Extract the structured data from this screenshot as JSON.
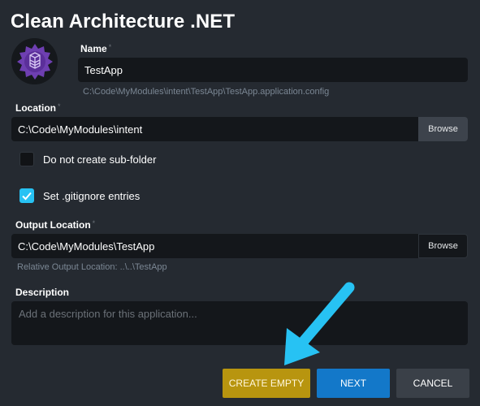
{
  "dialog": {
    "title": "Clean Architecture .NET"
  },
  "name": {
    "label": "Name",
    "value": "TestApp",
    "config_path": "C:\\Code\\MyModules\\intent\\TestApp\\TestApp.application.config"
  },
  "location": {
    "label": "Location",
    "value": "C:\\Code\\MyModules\\intent",
    "browse_label": "Browse"
  },
  "options": {
    "no_subfolder_label": "Do not create sub-folder",
    "no_subfolder_checked": false,
    "gitignore_label": "Set .gitignore entries",
    "gitignore_checked": true
  },
  "output": {
    "label": "Output Location",
    "value": "C:\\Code\\MyModules\\TestApp",
    "browse_label": "Browse",
    "relative_hint": "Relative Output Location: ..\\..\\TestApp"
  },
  "description": {
    "label": "Description",
    "placeholder": "Add a description for this application..."
  },
  "buttons": {
    "create_empty": "CREATE EMPTY",
    "next": "NEXT",
    "cancel": "CANCEL"
  },
  "colors": {
    "background": "#252a31",
    "input": "#14171b",
    "create_empty": "#b8950f",
    "next": "#1378c9",
    "cancel": "#3a4048",
    "checkbox_on": "#27c2f3",
    "annotation_arrow": "#27c2f3",
    "logo_accent": "#6e3fb1"
  }
}
